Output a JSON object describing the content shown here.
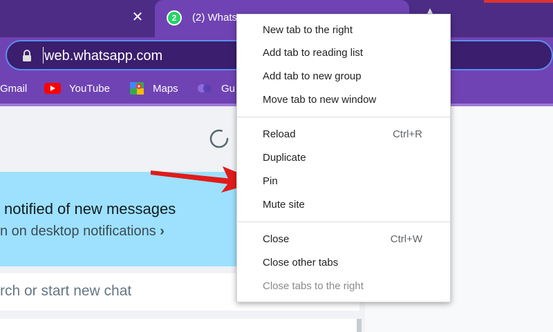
{
  "browser": {
    "active_tab": {
      "title": "(2) Whats",
      "badge": "2"
    },
    "address_bar": {
      "url": "web.whatsapp.com"
    },
    "bookmarks": [
      {
        "label": "Gmail",
        "icon": "gmail-icon"
      },
      {
        "label": "YouTube",
        "icon": "youtube-icon"
      },
      {
        "label": "Maps",
        "icon": "maps-icon"
      },
      {
        "label": "Gu",
        "icon": "bookmark-icon"
      }
    ]
  },
  "page": {
    "banner": {
      "title": "notified of new messages",
      "subtitle": "n on desktop notifications",
      "chevron": "›"
    },
    "search_placeholder": "rch or start new chat"
  },
  "context_menu": {
    "groups": [
      [
        {
          "label": "New tab to the right"
        },
        {
          "label": "Add tab to reading list"
        },
        {
          "label": "Add tab to new group"
        },
        {
          "label": "Move tab to new window"
        }
      ],
      [
        {
          "label": "Reload",
          "shortcut": "Ctrl+R"
        },
        {
          "label": "Duplicate"
        },
        {
          "label": "Pin"
        },
        {
          "label": "Mute site"
        }
      ],
      [
        {
          "label": "Close",
          "shortcut": "Ctrl+W"
        },
        {
          "label": "Close other tabs"
        },
        {
          "label": "Close tabs to the right",
          "disabled": true
        }
      ]
    ]
  },
  "colors": {
    "tabstrip": "#4d2c86",
    "toolbar": "#6f43b3",
    "banner": "#9de1fe",
    "whatsapp_green": "#25d366",
    "arrow": "#e01b1b"
  }
}
